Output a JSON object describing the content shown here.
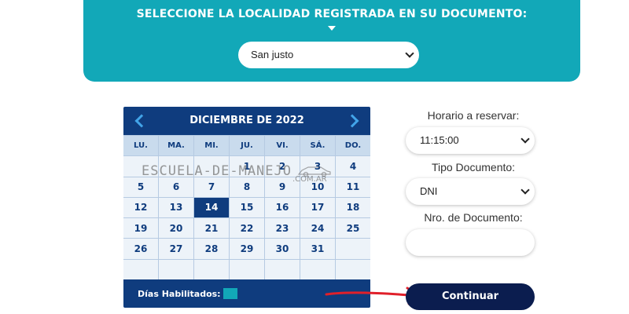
{
  "location_panel": {
    "title": "SELECCIONE LA LOCALIDAD REGISTRADA EN SU DOCUMENTO:",
    "selected_location": "San justo"
  },
  "calendar": {
    "month_title": "DICIEMBRE DE 2022",
    "weekdays": [
      "LU.",
      "MA.",
      "MI.",
      "JU.",
      "VI.",
      "SÁ.",
      "DO."
    ],
    "weeks": [
      [
        "",
        "",
        "",
        "1",
        "2",
        "3",
        "4"
      ],
      [
        "5",
        "6",
        "7",
        "8",
        "9",
        "10",
        "11"
      ],
      [
        "12",
        "13",
        "14",
        "15",
        "16",
        "17",
        "18"
      ],
      [
        "19",
        "20",
        "21",
        "22",
        "23",
        "24",
        "25"
      ],
      [
        "26",
        "27",
        "28",
        "29",
        "30",
        "31",
        ""
      ],
      [
        "",
        "",
        "",
        "",
        "",
        "",
        ""
      ]
    ],
    "selected_day": "14",
    "legend_label": "Días Habilitados:"
  },
  "form": {
    "time_label": "Horario a reservar:",
    "time_value": "11:15:00",
    "doc_type_label": "Tipo Documento:",
    "doc_type_value": "DNI",
    "doc_number_label": "Nro. de Documento:",
    "doc_number_value": "",
    "continue_label": "Continuar"
  },
  "watermark": {
    "text": "ESCUELA-DE-MANEJO",
    "sub": ".COM.AR"
  },
  "colors": {
    "accent_teal": "#12a8b8",
    "calendar_navy": "#0f3c7e",
    "button_navy": "#0b1d4f",
    "annotation_red": "#e0202a"
  }
}
